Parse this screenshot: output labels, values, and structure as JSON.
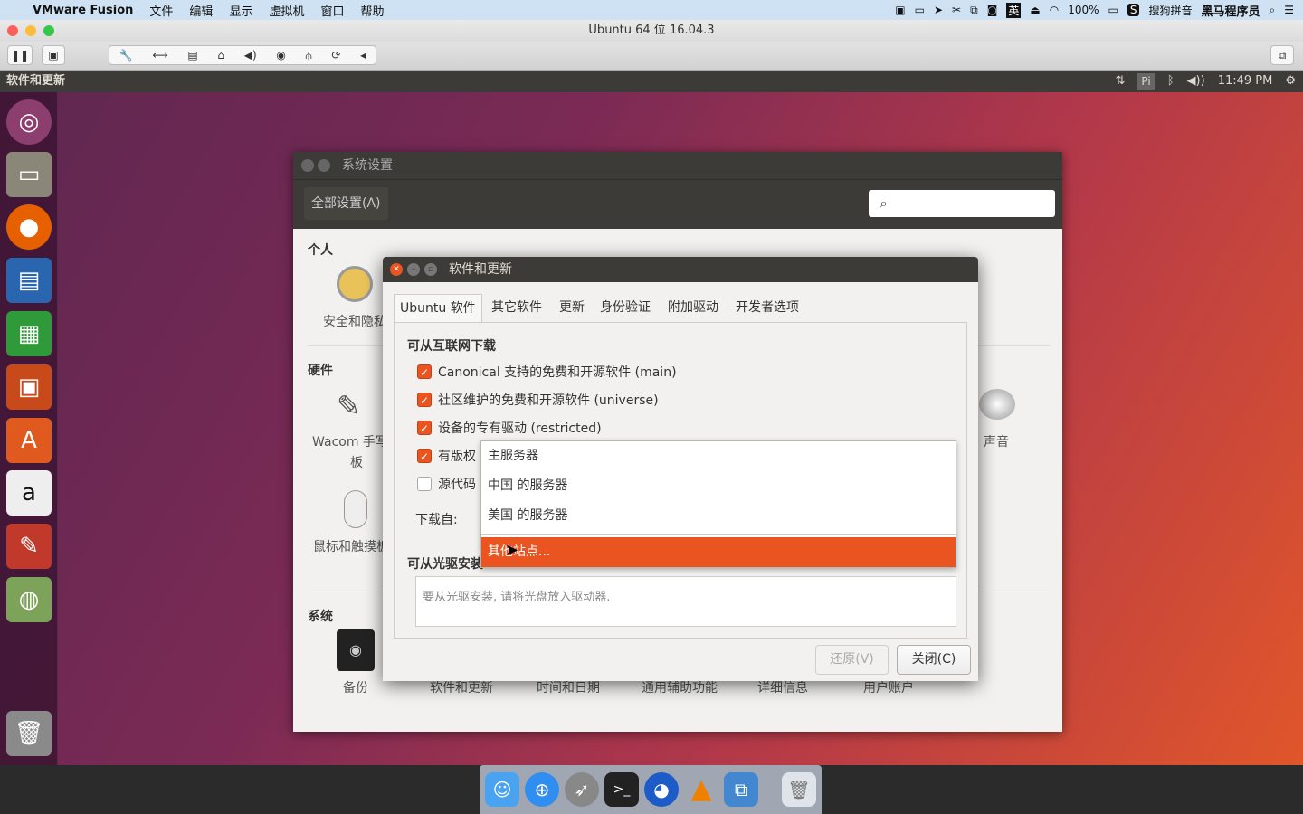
{
  "mac_menu": {
    "app": "VMware Fusion",
    "items": [
      "文件",
      "编辑",
      "显示",
      "虚拟机",
      "窗口",
      "帮助"
    ],
    "battery": "100%",
    "input_method": "搜狗拼音",
    "user": "黑马程序员"
  },
  "vm_window": {
    "title": "Ubuntu 64 位 16.04.3"
  },
  "ubuntu_panel": {
    "app_title": "软件和更新",
    "indicator_pi": "Pi",
    "time": "11:49 PM"
  },
  "system_settings": {
    "title": "系统设置",
    "all_settings": "全部设置(A)",
    "search_placeholder": "",
    "sections": {
      "personal": "个人",
      "hardware": "硬件",
      "system": "系统"
    },
    "items": {
      "security": "安全和隐私",
      "wacom": "Wacom 手写板",
      "wacom_2": "板",
      "mouse": "鼠标和触摸板",
      "sound": "声音",
      "backup": "备份",
      "software": "软件和更新",
      "datetime": "时间和日期",
      "accessibility": "通用辅助功能",
      "details": "详细信息",
      "users": "用户账户"
    }
  },
  "dialog": {
    "title": "软件和更新",
    "tabs": [
      "Ubuntu 软件",
      "其它软件",
      "更新",
      "身份验证",
      "附加驱动",
      "开发者选项"
    ],
    "internet_heading": "可从互联网下载",
    "checkboxes": [
      {
        "label": "Canonical 支持的免费和开源软件 (main)",
        "checked": true
      },
      {
        "label": "社区维护的免费和开源软件 (universe)",
        "checked": true
      },
      {
        "label": "设备的专有驱动 (restricted)",
        "checked": true
      },
      {
        "label": "有版权",
        "checked": true
      },
      {
        "label": "源代码",
        "checked": false
      }
    ],
    "download_from_label": "下载自:",
    "dropdown_options": [
      "主服务器",
      "中国 的服务器",
      "美国 的服务器",
      "其他站点..."
    ],
    "selected_option": "其他站点...",
    "cdrom_heading": "可从光驱安装",
    "cdrom_text": "要从光驱安装, 请将光盘放入驱动器.",
    "revert_button": "还原(V)",
    "close_button": "关闭(C)"
  },
  "colors": {
    "accent": "#e95420",
    "panel": "#3c3b37"
  }
}
